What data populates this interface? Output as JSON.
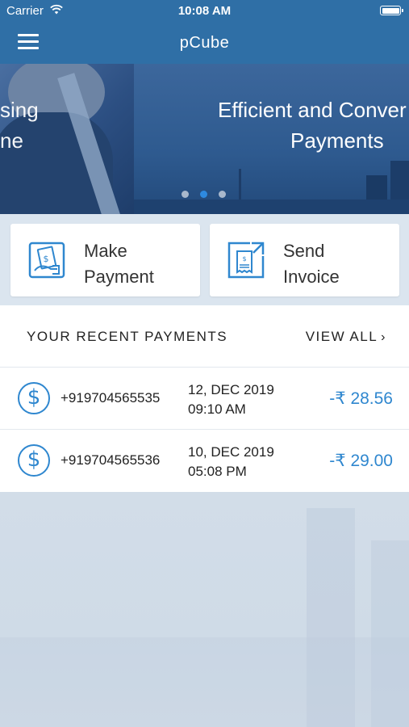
{
  "status_bar": {
    "carrier": "Carrier",
    "time": "10:08 AM"
  },
  "nav": {
    "title": "pCube"
  },
  "banner": {
    "slide_left_text": "sing\nne",
    "slide_right_line1": "Efficient and Conver",
    "slide_right_line2": "Payments",
    "active_dot_index": 1
  },
  "actions": {
    "make_payment_label": "Make\nPayment",
    "send_invoice_label": "Send\nInvoice"
  },
  "recent": {
    "title": "YOUR RECENT PAYMENTS",
    "view_all": "VIEW ALL",
    "payments": [
      {
        "phone": "+919704565535",
        "date": "12, DEC 2019",
        "time": "09:10 AM",
        "amount": "-₹ 28.56"
      },
      {
        "phone": "+919704565536",
        "date": "10, DEC 2019",
        "time": "05:08 PM",
        "amount": "-₹ 29.00"
      }
    ]
  },
  "colors": {
    "header": "#2f6fa6",
    "accent": "#2f87cf",
    "active_dot": "#2e8ae0"
  },
  "icons": [
    "wifi-icon",
    "battery-icon",
    "menu-icon",
    "wallet-icon",
    "invoice-send-icon",
    "dollar-icon",
    "chevron-right-icon"
  ]
}
